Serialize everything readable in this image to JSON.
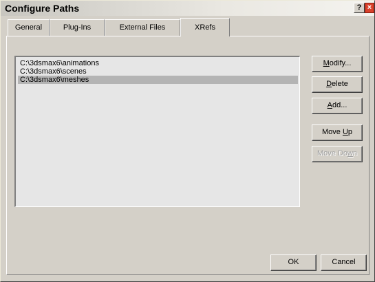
{
  "window": {
    "title": "Configure Paths",
    "help_label": "?",
    "close_label": "×"
  },
  "tabs": [
    {
      "label": "General"
    },
    {
      "label": "Plug-Ins"
    },
    {
      "label": "External Files"
    },
    {
      "label": "XRefs",
      "active": true
    }
  ],
  "paths": [
    {
      "text": "C:\\3dsmax6\\animations"
    },
    {
      "text": "C:\\3dsmax6\\scenes"
    },
    {
      "text": "C:\\3dsmax6\\meshes",
      "selected": true
    }
  ],
  "buttons": {
    "modify": {
      "pre": "",
      "mn": "M",
      "post": "odify..."
    },
    "delete": {
      "pre": "",
      "mn": "D",
      "post": "elete"
    },
    "add": {
      "pre": "",
      "mn": "A",
      "post": "dd..."
    },
    "move_up": {
      "pre": "Move ",
      "mn": "U",
      "post": "p"
    },
    "move_down": {
      "pre": "Move Do",
      "mn": "w",
      "post": "n",
      "disabled": true
    },
    "ok": "OK",
    "cancel": "Cancel"
  }
}
